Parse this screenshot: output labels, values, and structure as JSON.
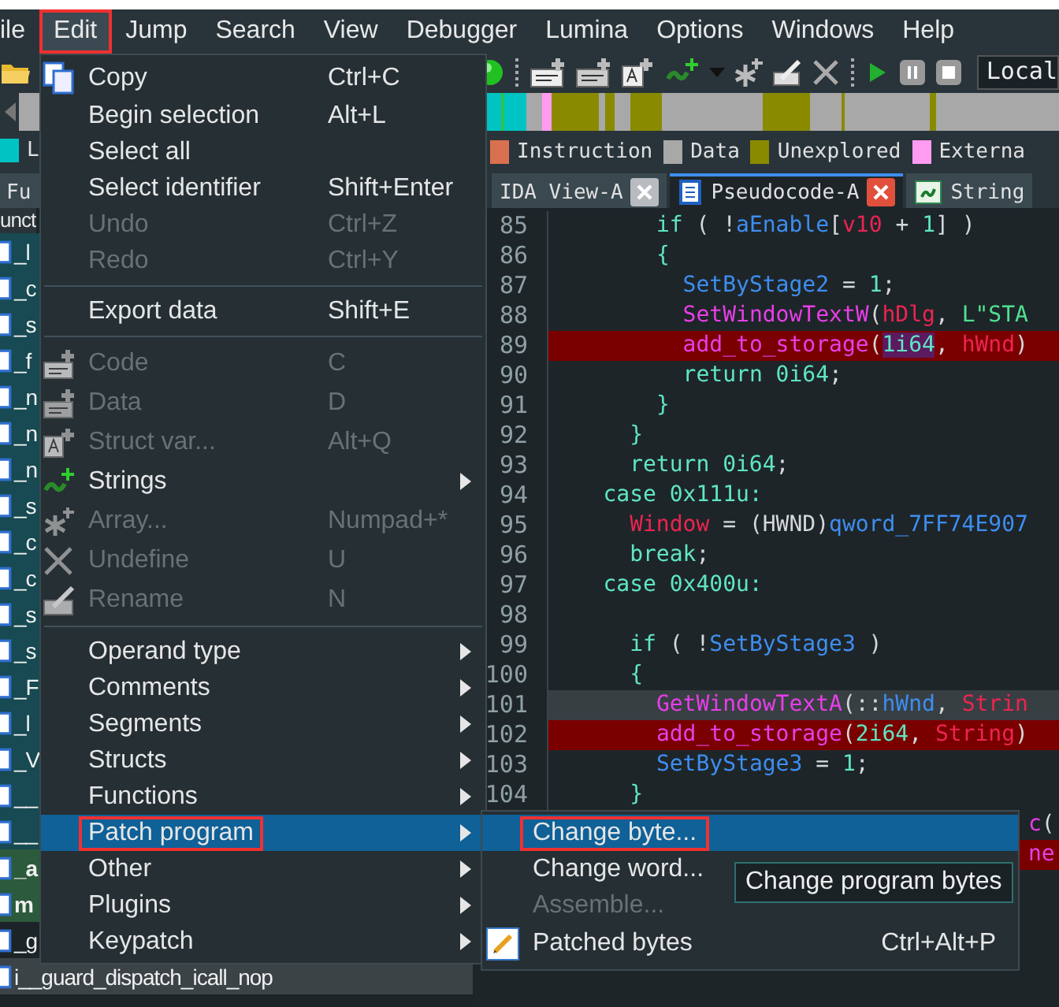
{
  "menubar": [
    {
      "label": "ile",
      "selected": false,
      "annotated": false
    },
    {
      "label": "Edit",
      "selected": true,
      "annotated": true
    },
    {
      "label": "Jump",
      "selected": false,
      "annotated": false
    },
    {
      "label": "Search",
      "selected": false,
      "annotated": false
    },
    {
      "label": "View",
      "selected": false,
      "annotated": false
    },
    {
      "label": "Debugger",
      "selected": false,
      "annotated": false
    },
    {
      "label": "Lumina",
      "selected": false,
      "annotated": false
    },
    {
      "label": "Options",
      "selected": false,
      "annotated": false
    },
    {
      "label": "Windows",
      "selected": false,
      "annotated": false
    },
    {
      "label": "Help",
      "selected": false,
      "annotated": false
    }
  ],
  "toolbar": {
    "debugger_field": "Local"
  },
  "legend": [
    {
      "label": "L",
      "color": "#00c4c4"
    },
    {
      "label": "Instruction",
      "color": "#d9704f"
    },
    {
      "label": "Data",
      "color": "#a8a8a8"
    },
    {
      "label": "Unexplored",
      "color": "#8a8a00"
    },
    {
      "label": "Externa",
      "color": "#ff9cf2"
    }
  ],
  "tabs": [
    {
      "label": "Fu",
      "selected": false,
      "closable": false
    },
    {
      "label": "IDA View-A",
      "selected": false,
      "closable": true
    },
    {
      "label": "Pseudocode-A",
      "selected": true,
      "closable": true
    },
    {
      "label": "String",
      "selected": false,
      "closable": false
    }
  ],
  "functions": {
    "header": "unct",
    "rows": [
      {
        "name": "_l",
        "kind": "library"
      },
      {
        "name": "_c",
        "kind": "library"
      },
      {
        "name": "_s",
        "kind": "library"
      },
      {
        "name": "_f",
        "kind": "library"
      },
      {
        "name": "_n",
        "kind": "library"
      },
      {
        "name": "_n",
        "kind": "library"
      },
      {
        "name": "_n",
        "kind": "library"
      },
      {
        "name": "_s",
        "kind": "library"
      },
      {
        "name": "_c",
        "kind": "library"
      },
      {
        "name": "_c",
        "kind": "library"
      },
      {
        "name": "_s",
        "kind": "library"
      },
      {
        "name": "_s",
        "kind": "library"
      },
      {
        "name": "_F",
        "kind": "library"
      },
      {
        "name": "_l",
        "kind": "library"
      },
      {
        "name": "_V",
        "kind": "library"
      },
      {
        "name": "__",
        "kind": "library"
      },
      {
        "name": "__",
        "kind": "library"
      },
      {
        "name": "_a",
        "kind": "user"
      },
      {
        "name": "m",
        "kind": "user"
      },
      {
        "name": "_g",
        "kind": "plain"
      },
      {
        "name": "i__guard_dispatch_icall_nop",
        "kind": "current"
      }
    ]
  },
  "code": [
    {
      "number": "85",
      "breakpoint": false,
      "current": false,
      "tokens": [
        {
          "text": "        if",
          "kind": "kw"
        },
        {
          "text": " ( !",
          "kind": "p"
        },
        {
          "text": "aEnable",
          "kind": "glob"
        },
        {
          "text": "[",
          "kind": "p"
        },
        {
          "text": "v10",
          "kind": "loc"
        },
        {
          "text": " + ",
          "kind": "p"
        },
        {
          "text": "1",
          "kind": "num"
        },
        {
          "text": "] )",
          "kind": "p"
        }
      ]
    },
    {
      "number": "86",
      "breakpoint": false,
      "current": false,
      "tokens": [
        {
          "text": "        {",
          "kind": "kw"
        }
      ]
    },
    {
      "number": "87",
      "breakpoint": false,
      "current": false,
      "tokens": [
        {
          "text": "          SetByStage2",
          "kind": "glob"
        },
        {
          "text": " = ",
          "kind": "p"
        },
        {
          "text": "1",
          "kind": "num"
        },
        {
          "text": ";",
          "kind": "p"
        }
      ]
    },
    {
      "number": "88",
      "breakpoint": false,
      "current": false,
      "tokens": [
        {
          "text": "          SetWindowTextW",
          "kind": "fn"
        },
        {
          "text": "(",
          "kind": "p"
        },
        {
          "text": "hDlg",
          "kind": "loc"
        },
        {
          "text": ", ",
          "kind": "p"
        },
        {
          "text": "L\"STA",
          "kind": "str"
        }
      ]
    },
    {
      "number": "89",
      "breakpoint": true,
      "current": false,
      "tokens": [
        {
          "text": "          add_to_storage",
          "kind": "fn"
        },
        {
          "text": "(",
          "kind": "p"
        },
        {
          "text": "1i64",
          "kind": "sel"
        },
        {
          "text": ", ",
          "kind": "p"
        },
        {
          "text": "hWnd",
          "kind": "loc"
        },
        {
          "text": ")",
          "kind": "p"
        }
      ]
    },
    {
      "number": "90",
      "breakpoint": false,
      "current": false,
      "tokens": [
        {
          "text": "          return 0i64",
          "kind": "kw"
        },
        {
          "text": ";",
          "kind": "p"
        }
      ]
    },
    {
      "number": "91",
      "breakpoint": false,
      "current": false,
      "tokens": [
        {
          "text": "        }",
          "kind": "kw"
        }
      ]
    },
    {
      "number": "92",
      "breakpoint": false,
      "current": false,
      "tokens": [
        {
          "text": "      }",
          "kind": "kw"
        }
      ]
    },
    {
      "number": "93",
      "breakpoint": false,
      "current": false,
      "tokens": [
        {
          "text": "      return 0i64",
          "kind": "kw"
        },
        {
          "text": ";",
          "kind": "p"
        }
      ]
    },
    {
      "number": "94",
      "breakpoint": false,
      "current": false,
      "tokens": [
        {
          "text": "    case 0x111u:",
          "kind": "kw"
        }
      ]
    },
    {
      "number": "95",
      "breakpoint": false,
      "current": false,
      "tokens": [
        {
          "text": "      Window",
          "kind": "loc"
        },
        {
          "text": " = (HWND)",
          "kind": "p"
        },
        {
          "text": "qword_7FF74E907",
          "kind": "glob"
        }
      ]
    },
    {
      "number": "96",
      "breakpoint": false,
      "current": false,
      "tokens": [
        {
          "text": "      break",
          "kind": "kw"
        },
        {
          "text": ";",
          "kind": "p"
        }
      ]
    },
    {
      "number": "97",
      "breakpoint": false,
      "current": false,
      "tokens": [
        {
          "text": "    case 0x400u:",
          "kind": "kw"
        }
      ]
    },
    {
      "number": "98",
      "breakpoint": false,
      "current": false
    },
    {
      "number": "99",
      "breakpoint": false,
      "current": false,
      "tokens": [
        {
          "text": "      if",
          "kind": "kw"
        },
        {
          "text": " ( !",
          "kind": "p"
        },
        {
          "text": "SetByStage3",
          "kind": "glob"
        },
        {
          "text": " )",
          "kind": "p"
        }
      ]
    },
    {
      "number": "100",
      "breakpoint": false,
      "current": false,
      "tokens": [
        {
          "text": "      {",
          "kind": "kw"
        }
      ]
    },
    {
      "number": "101",
      "breakpoint": false,
      "current": true,
      "tokens": [
        {
          "text": "        GetWindowTextA",
          "kind": "fn"
        },
        {
          "text": "(::",
          "kind": "p"
        },
        {
          "text": "hWnd",
          "kind": "glob"
        },
        {
          "text": ", ",
          "kind": "p"
        },
        {
          "text": "Strin",
          "kind": "loc"
        }
      ]
    },
    {
      "number": "102",
      "breakpoint": true,
      "current": false,
      "tokens": [
        {
          "text": "        add_to_storage",
          "kind": "fn"
        },
        {
          "text": "(",
          "kind": "p"
        },
        {
          "text": "2i64",
          "kind": "num"
        },
        {
          "text": ", ",
          "kind": "p"
        },
        {
          "text": "String",
          "kind": "loc"
        },
        {
          "text": ")",
          "kind": "p"
        }
      ]
    },
    {
      "number": "103",
      "breakpoint": false,
      "current": false,
      "tokens": [
        {
          "text": "        SetByStage3",
          "kind": "glob"
        },
        {
          "text": " = ",
          "kind": "p"
        },
        {
          "text": "1",
          "kind": "num"
        },
        {
          "text": ";",
          "kind": "p"
        }
      ]
    },
    {
      "number": "104",
      "breakpoint": false,
      "current": false,
      "tokens": [
        {
          "text": "      }",
          "kind": "kw"
        }
      ]
    },
    {
      "breakpoint": false,
      "current": false,
      "tokens": [
        {
          "text": "                                    c",
          "kind": "fn"
        },
        {
          "text": "(",
          "kind": "p"
        }
      ]
    },
    {
      "breakpoint": true,
      "current": false,
      "tokens": [
        {
          "text": "                                    ne",
          "kind": "fn"
        }
      ]
    }
  ],
  "edit_menu": [
    {
      "kind": "item",
      "label": "Copy",
      "shortcut": "Ctrl+C",
      "disabled": false,
      "submenu": false,
      "selected": false,
      "annotated": false
    },
    {
      "kind": "item",
      "label": "Begin selection",
      "shortcut": "Alt+L",
      "disabled": false,
      "submenu": false,
      "selected": false,
      "annotated": false
    },
    {
      "kind": "item",
      "label": "Select all",
      "disabled": false,
      "submenu": false,
      "selected": false,
      "annotated": false
    },
    {
      "kind": "item",
      "label": "Select identifier",
      "shortcut": "Shift+Enter",
      "disabled": false,
      "submenu": false,
      "selected": false,
      "annotated": false
    },
    {
      "kind": "item",
      "label": "Undo",
      "shortcut": "Ctrl+Z",
      "disabled": true,
      "submenu": false,
      "selected": false,
      "annotated": false
    },
    {
      "kind": "item",
      "label": "Redo",
      "shortcut": "Ctrl+Y",
      "disabled": true,
      "submenu": false,
      "selected": false,
      "annotated": false
    },
    {
      "kind": "separator"
    },
    {
      "kind": "item",
      "label": "Export data",
      "shortcut": "Shift+E",
      "disabled": false,
      "submenu": false,
      "selected": false,
      "annotated": false
    },
    {
      "kind": "separator"
    },
    {
      "kind": "item",
      "label": "Code",
      "shortcut": "C",
      "disabled": true,
      "submenu": false,
      "selected": false,
      "annotated": false
    },
    {
      "kind": "item",
      "label": "Data",
      "shortcut": "D",
      "disabled": true,
      "submenu": false,
      "selected": false,
      "annotated": false
    },
    {
      "kind": "item",
      "label": "Struct var...",
      "shortcut": "Alt+Q",
      "disabled": true,
      "submenu": false,
      "selected": false,
      "annotated": false
    },
    {
      "kind": "item",
      "label": "Strings",
      "disabled": false,
      "submenu": true,
      "selected": false,
      "annotated": false
    },
    {
      "kind": "item",
      "label": "Array...",
      "shortcut": "Numpad+*",
      "disabled": true,
      "submenu": false,
      "selected": false,
      "annotated": false
    },
    {
      "kind": "item",
      "label": "Undefine",
      "shortcut": "U",
      "disabled": true,
      "submenu": false,
      "selected": false,
      "annotated": false
    },
    {
      "kind": "item",
      "label": "Rename",
      "shortcut": "N",
      "disabled": true,
      "submenu": false,
      "selected": false,
      "annotated": false
    },
    {
      "kind": "separator"
    },
    {
      "kind": "item",
      "label": "Operand type",
      "disabled": false,
      "submenu": true,
      "selected": false,
      "annotated": false
    },
    {
      "kind": "item",
      "label": "Comments",
      "disabled": false,
      "submenu": true,
      "selected": false,
      "annotated": false
    },
    {
      "kind": "item",
      "label": "Segments",
      "disabled": false,
      "submenu": true,
      "selected": false,
      "annotated": false
    },
    {
      "kind": "item",
      "label": "Structs",
      "disabled": false,
      "submenu": true,
      "selected": false,
      "annotated": false
    },
    {
      "kind": "item",
      "label": "Functions",
      "disabled": false,
      "submenu": true,
      "selected": false,
      "annotated": false
    },
    {
      "kind": "item",
      "label": "Patch program",
      "disabled": false,
      "submenu": true,
      "selected": true,
      "annotated": true
    },
    {
      "kind": "item",
      "label": "Other",
      "disabled": false,
      "submenu": true,
      "selected": false,
      "annotated": false
    },
    {
      "kind": "item",
      "label": "Plugins",
      "disabled": false,
      "submenu": true,
      "selected": false,
      "annotated": false
    },
    {
      "kind": "item",
      "label": "Keypatch",
      "disabled": false,
      "submenu": true,
      "selected": false,
      "annotated": false
    }
  ],
  "patch_submenu": [
    {
      "label": "Change byte...",
      "disabled": false,
      "selected": true,
      "annotated": true
    },
    {
      "label": "Change word...",
      "disabled": false,
      "selected": false,
      "annotated": false
    },
    {
      "label": "Assemble...",
      "disabled": true,
      "selected": false,
      "annotated": false
    },
    {
      "label": "Patched bytes",
      "shortcut": "Ctrl+Alt+P",
      "disabled": false,
      "selected": false,
      "annotated": false
    }
  ],
  "tooltip": "Change program bytes"
}
